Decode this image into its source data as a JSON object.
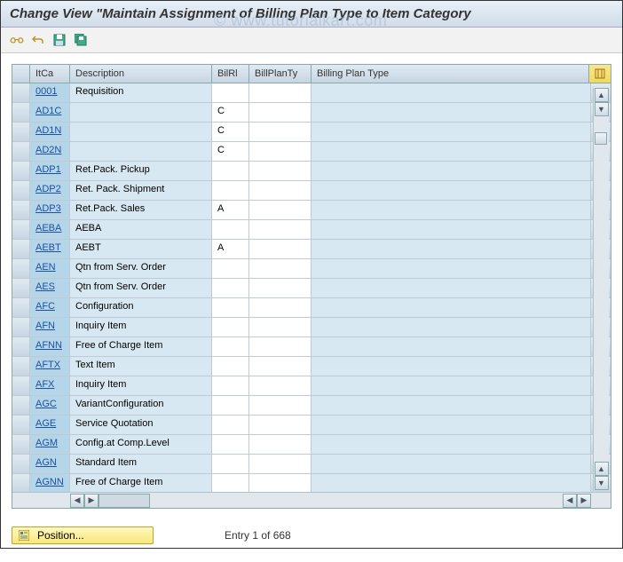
{
  "title": "Change View \"Maintain Assignment of Billing Plan Type to Item Category",
  "watermark": "© www.tutorialkart.com",
  "toolbar": {
    "items": [
      {
        "name": "other-view-icon"
      },
      {
        "name": "undo-icon"
      },
      {
        "name": "save-icon"
      },
      {
        "name": "save-all-icon"
      }
    ]
  },
  "table": {
    "headers": {
      "itca": "ItCa",
      "desc": "Description",
      "bilrl": "BilRl",
      "bplanty": "BillPlanTy",
      "bplantype": "Billing Plan Type"
    },
    "rows": [
      {
        "itca": "0001",
        "desc": "Requisition",
        "bilrl": "",
        "bplanty": "",
        "bplantype": ""
      },
      {
        "itca": "AD1C",
        "desc": "",
        "bilrl": "C",
        "bplanty": "",
        "bplantype": ""
      },
      {
        "itca": "AD1N",
        "desc": "",
        "bilrl": "C",
        "bplanty": "",
        "bplantype": ""
      },
      {
        "itca": "AD2N",
        "desc": "",
        "bilrl": "C",
        "bplanty": "",
        "bplantype": ""
      },
      {
        "itca": "ADP1",
        "desc": "Ret.Pack. Pickup",
        "bilrl": "",
        "bplanty": "",
        "bplantype": ""
      },
      {
        "itca": "ADP2",
        "desc": "Ret. Pack. Shipment",
        "bilrl": "",
        "bplanty": "",
        "bplantype": ""
      },
      {
        "itca": "ADP3",
        "desc": "Ret.Pack. Sales",
        "bilrl": "A",
        "bplanty": "",
        "bplantype": ""
      },
      {
        "itca": "AEBA",
        "desc": "AEBA",
        "bilrl": "",
        "bplanty": "",
        "bplantype": ""
      },
      {
        "itca": "AEBT",
        "desc": "AEBT",
        "bilrl": "A",
        "bplanty": "",
        "bplantype": ""
      },
      {
        "itca": "AEN",
        "desc": "Qtn from Serv. Order",
        "bilrl": "",
        "bplanty": "",
        "bplantype": ""
      },
      {
        "itca": "AES",
        "desc": "Qtn from Serv. Order",
        "bilrl": "",
        "bplanty": "",
        "bplantype": ""
      },
      {
        "itca": "AFC",
        "desc": "Configuration",
        "bilrl": "",
        "bplanty": "",
        "bplantype": ""
      },
      {
        "itca": "AFN",
        "desc": "Inquiry Item",
        "bilrl": "",
        "bplanty": "",
        "bplantype": ""
      },
      {
        "itca": "AFNN",
        "desc": "Free of Charge Item",
        "bilrl": "",
        "bplanty": "",
        "bplantype": ""
      },
      {
        "itca": "AFTX",
        "desc": "Text Item",
        "bilrl": "",
        "bplanty": "",
        "bplantype": ""
      },
      {
        "itca": "AFX",
        "desc": "Inquiry Item",
        "bilrl": "",
        "bplanty": "",
        "bplantype": ""
      },
      {
        "itca": "AGC",
        "desc": "VariantConfiguration",
        "bilrl": "",
        "bplanty": "",
        "bplantype": ""
      },
      {
        "itca": "AGE",
        "desc": "Service Quotation",
        "bilrl": "",
        "bplanty": "",
        "bplantype": ""
      },
      {
        "itca": "AGM",
        "desc": "Config.at Comp.Level",
        "bilrl": "",
        "bplanty": "",
        "bplantype": ""
      },
      {
        "itca": "AGN",
        "desc": "Standard Item",
        "bilrl": "",
        "bplanty": "",
        "bplantype": ""
      },
      {
        "itca": "AGNN",
        "desc": "Free of Charge Item",
        "bilrl": "",
        "bplanty": "",
        "bplantype": ""
      }
    ]
  },
  "footer": {
    "position_label": "Position...",
    "status": "Entry 1 of 668"
  }
}
